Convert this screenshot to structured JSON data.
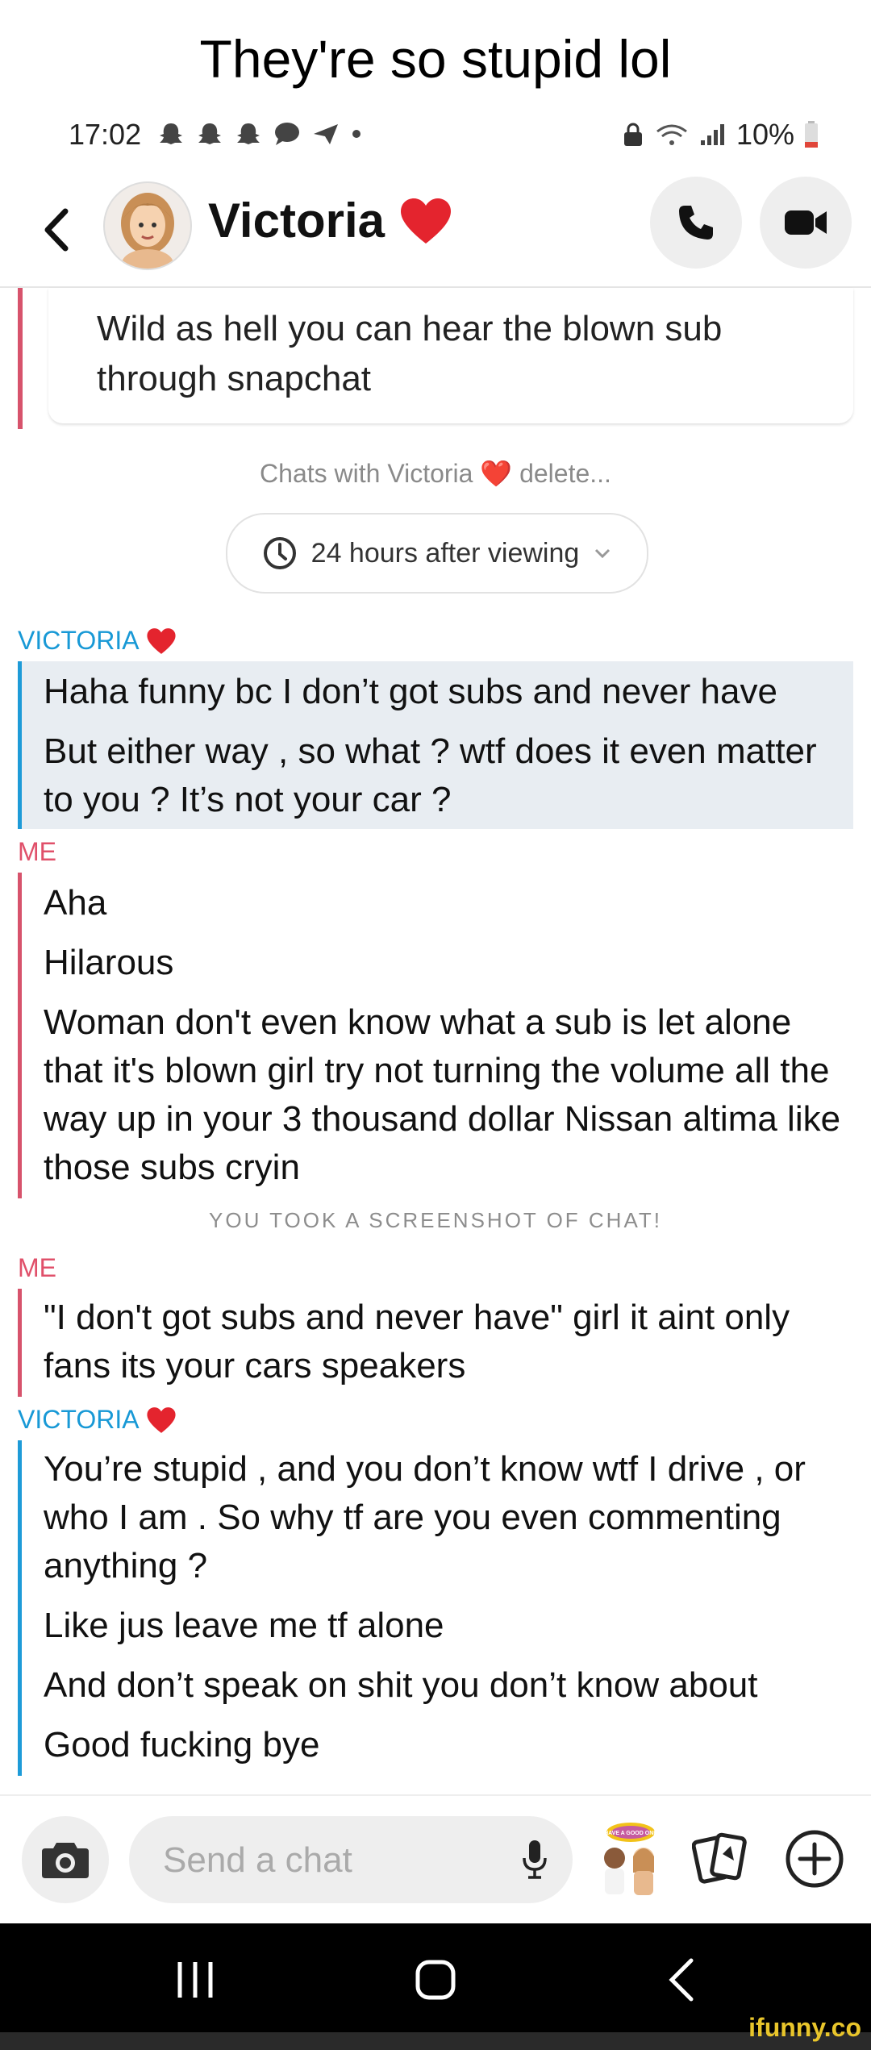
{
  "caption": "They're so stupid lol",
  "status_bar": {
    "time": "17:02",
    "battery": "10%"
  },
  "header": {
    "contact_name": "Victoria",
    "heart": "❤️"
  },
  "quoted_message": {
    "text": "Wild as hell you can hear the blown sub through snapchat"
  },
  "chat_settings": {
    "info": "Chats with Victoria ❤️ delete...",
    "timer": "24 hours after viewing"
  },
  "messages": [
    {
      "sender": "VICTORIA",
      "lines": [
        "Haha funny bc I don’t got subs and never have",
        "But either way , so what ? wtf does it even matter to you ? It’s not your car ?"
      ]
    },
    {
      "sender": "ME",
      "lines": [
        "Aha",
        "Hilarous",
        "Woman don't even know what a sub is let alone that it's blown girl try not turning the volume all the way up in your 3 thousand dollar Nissan altima like those subs cryin"
      ]
    },
    {
      "sender": "ME",
      "lines": [
        "\"I don't got subs and never have\" girl it aint only fans its your cars speakers"
      ]
    },
    {
      "sender": "VICTORIA",
      "lines": [
        "You’re stupid , and you don’t know wtf I drive , or who I am . So why tf are you even commenting anything ?",
        "Like jus leave me tf alone",
        "And don’t speak on shit you don’t know about",
        "Good fucking bye"
      ]
    }
  ],
  "screenshot_note": "YOU TOOK A SCREENSHOT OF CHAT!",
  "input": {
    "placeholder": "Send a chat",
    "bitmoji_caption": "HAVE A GOOD ONE"
  },
  "watermark": "ifunny.co",
  "colors": {
    "victoria": "#1899d6",
    "me": "#e0506a"
  }
}
